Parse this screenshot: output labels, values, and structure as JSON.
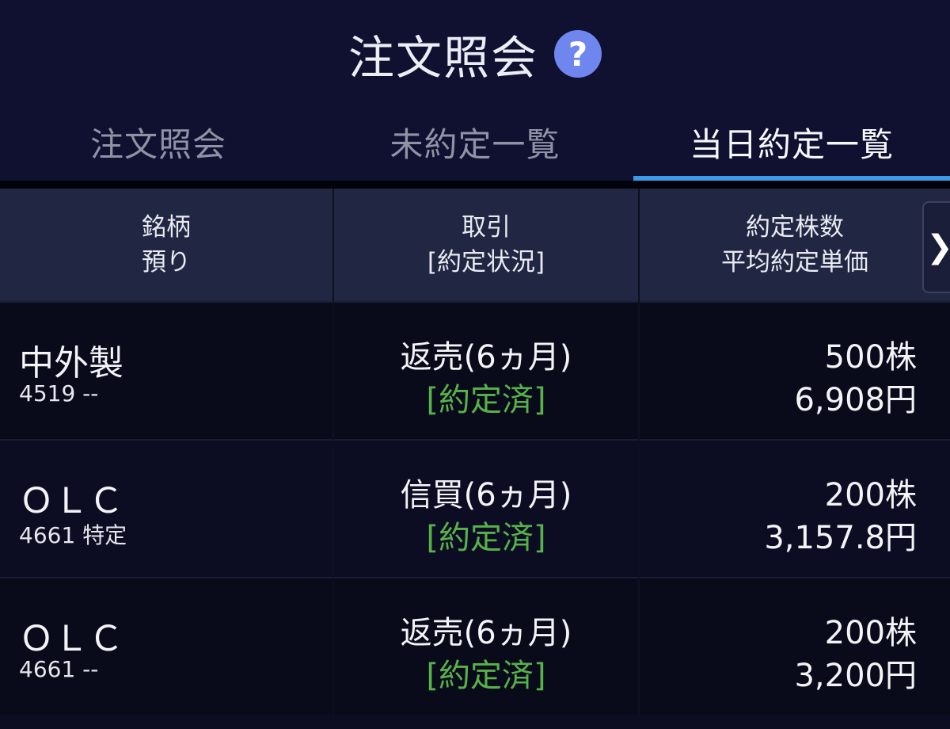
{
  "header": {
    "title": "注文照会",
    "help_icon": "question-circle-icon",
    "help_glyph": "?"
  },
  "tabs": [
    {
      "label": "注文照会",
      "active": false
    },
    {
      "label": "未約定一覧",
      "active": false
    },
    {
      "label": "当日約定一覧",
      "active": true
    }
  ],
  "accent_color": "#3a9ae6",
  "status_color": "#57b24a",
  "table": {
    "columns": [
      {
        "line1": "銘柄",
        "line2": "預り"
      },
      {
        "line1": "取引",
        "line2": "[約定状況]"
      },
      {
        "line1": "約定株数",
        "line2": "平均約定単価"
      }
    ],
    "scroll_icon": "chevron-right-icon",
    "scroll_glyph": "❯",
    "rows": [
      {
        "name": "中外製",
        "code": "4519 --",
        "trade": "返売(6ヵ月)",
        "status": "[約定済]",
        "qty": "500株",
        "price": "6,908円"
      },
      {
        "name": "ＯＬＣ",
        "code": "4661 特定",
        "trade": "信買(6ヵ月)",
        "status": "[約定済]",
        "qty": "200株",
        "price": "3,157.8円"
      },
      {
        "name": "ＯＬＣ",
        "code": "4661 --",
        "trade": "返売(6ヵ月)",
        "status": "[約定済]",
        "qty": "200株",
        "price": "3,200円"
      }
    ]
  }
}
